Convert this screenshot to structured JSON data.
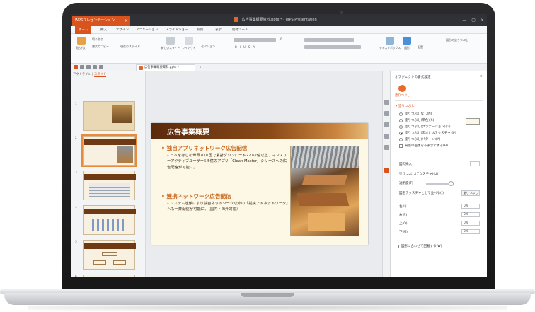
{
  "app": {
    "app_tab_label": "WPSプレゼンテーション",
    "window_title": "広告事業概要資料.pptx * - WPS Presentation",
    "window_controls": [
      "最小化",
      "最大化",
      "閉じる"
    ]
  },
  "ribbon": {
    "tabs": [
      "ホーム",
      "挿入",
      "デザイン",
      "アニメーション",
      "スライドショー",
      "校閲",
      "表示",
      "開発ツール"
    ],
    "active_tab": "ホーム",
    "buttons": [
      {
        "label": "貼り付け",
        "icon": "paste-icon"
      },
      {
        "label": "切り取り",
        "icon": "cut-icon"
      },
      {
        "label": "書式のコピー",
        "icon": "format-painter-icon"
      },
      {
        "label": "現在のスライド",
        "icon": "current-slide-icon"
      },
      {
        "label": "新しいスライド",
        "icon": "new-slide-icon"
      },
      {
        "label": "レイアウト",
        "icon": "layout-icon"
      },
      {
        "label": "セクション",
        "icon": "section-icon"
      },
      {
        "label": "テキストボックス",
        "icon": "textbox-icon"
      },
      {
        "label": "図形",
        "icon": "shapes-icon"
      },
      {
        "label": "配置",
        "icon": "arrange-icon"
      },
      {
        "label": "図形の塗りつぶし",
        "icon": "fill-icon"
      }
    ],
    "font_size_value": "0",
    "style_buttons": [
      "B",
      "I",
      "U",
      "S",
      "A"
    ]
  },
  "document_tab": {
    "label": "広告事業概要資料.pptx *",
    "add_label": "+"
  },
  "outline_pane": {
    "tabs": [
      "アウトライン",
      "スライド"
    ],
    "active_tab": "スライド",
    "slide_numbers": [
      "1",
      "2",
      "3",
      "4",
      "5",
      "6"
    ],
    "current_slide": "2"
  },
  "slide": {
    "title": "広告事業概要",
    "bullets": [
      {
        "heading": "独自アプリネットワーク広告配信",
        "detail": "日本をはじめ世界70カ国で累計ダウンロード27.62億以上、マンスリーアクティブユーザー5.5億のアプリ「Clean Master」シリーズへの広告配信が可能に。"
      },
      {
        "heading": "連携ネットワーク広告配信",
        "detail": "システム連係により独自ネットワーク以外の「提携アドネットワーク」へも一斉配信が可能に。（国内・海外対応）"
      }
    ]
  },
  "format_pane": {
    "title": "オブジェクトの書式設定",
    "tab_label": "塗りつぶし",
    "fill_section": "塗りつぶし",
    "fill_options": [
      {
        "label": "塗りつぶしなし(N)",
        "checked": false
      },
      {
        "label": "塗りつぶし(単色)(S)",
        "checked": false
      },
      {
        "label": "塗りつぶし(グラデーション)(G)",
        "checked": false
      },
      {
        "label": "塗りつぶし(図またはテクスチャ)(P)",
        "checked": true
      },
      {
        "label": "塗りつぶし(パターン)(A)",
        "checked": false
      }
    ],
    "hide_background_label": "背景の画像を非表示にする(H)",
    "insert_picture_label": "図の挿入",
    "texture_label": "塗りつぶし(テクスチャ)(U)",
    "transparency_label": "透明度(T)",
    "tile_label": "図をテクスチャとして並べる(I)",
    "tile_button": "塗りつぶし",
    "offsets": [
      {
        "label": "左(L)",
        "value": "0%"
      },
      {
        "label": "右(R)",
        "value": "0%"
      },
      {
        "label": "上(O)",
        "value": "0%"
      },
      {
        "label": "下(M)",
        "value": "0%"
      }
    ],
    "rotate_label": "図形に合わせて回転する(W)"
  },
  "colors": {
    "accent": "#d9531f",
    "title_band": "#6f3a13",
    "bullet_heading": "#c8681e",
    "slide_background": "#fdf7e6"
  }
}
